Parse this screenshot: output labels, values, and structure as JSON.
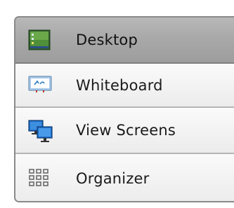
{
  "menu": {
    "items": [
      {
        "label": "Desktop",
        "icon": "desktop-icon",
        "active": true
      },
      {
        "label": "Whiteboard",
        "icon": "whiteboard-icon",
        "active": false
      },
      {
        "label": "View Screens",
        "icon": "view-screens-icon",
        "active": false
      },
      {
        "label": "Organizer",
        "icon": "organizer-grid-icon",
        "active": false
      }
    ]
  },
  "colors": {
    "active_bg": "#a9a9a9",
    "item_bg": "#f3f3f3",
    "border": "#8a8a8a",
    "monitor_blue": "#1e6fc8"
  }
}
